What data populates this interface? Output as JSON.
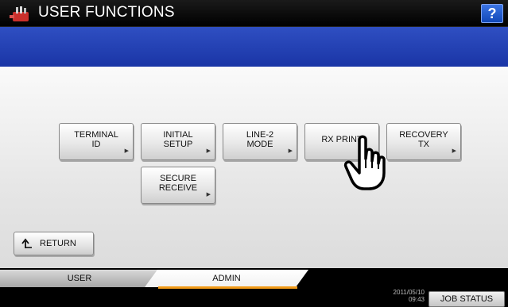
{
  "header": {
    "title": "USER FUNCTIONS",
    "app_icon": "tools-icon",
    "help_label": "?"
  },
  "buttons": [
    {
      "label": "TERMINAL\nID",
      "has_arrow": true
    },
    {
      "label": "INITIAL\nSETUP",
      "has_arrow": true
    },
    {
      "label": "LINE-2\nMODE",
      "has_arrow": true
    },
    {
      "label": "RX PRINT",
      "has_arrow": false
    },
    {
      "label": "RECOVERY\nTX",
      "has_arrow": true
    },
    {
      "label": "SECURE\nRECEIVE",
      "has_arrow": true
    }
  ],
  "return_button": {
    "label": "RETURN",
    "icon": "return-arrow-icon"
  },
  "tabs": [
    {
      "label": "USER",
      "active": false
    },
    {
      "label": "ADMIN",
      "active": true
    }
  ],
  "status": {
    "date": "2011/05/10",
    "time": "09:43",
    "job_status_label": "JOB STATUS"
  },
  "colors": {
    "header_bg": "#000000",
    "blue_band": "#2440b3",
    "help_button": "#1f5bd6",
    "active_tab_accent": "#f29b1a"
  },
  "cursor": {
    "icon": "hand-pointer-icon"
  }
}
